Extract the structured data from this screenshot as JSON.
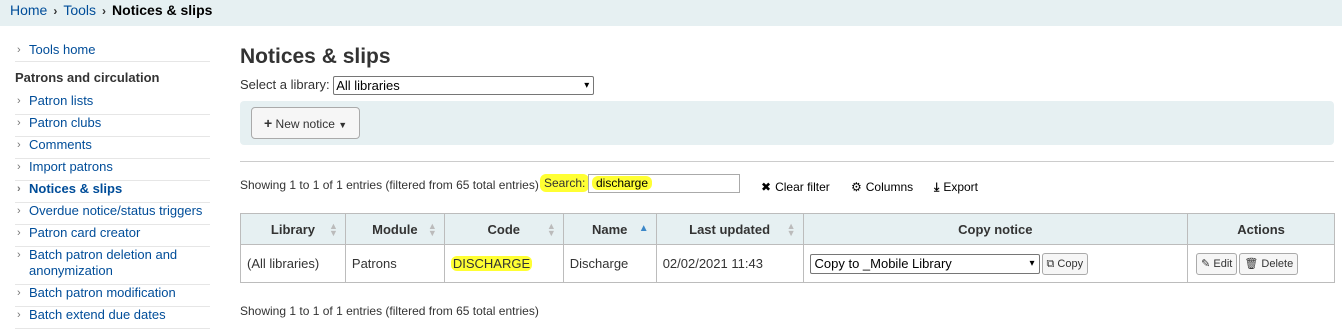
{
  "breadcrumb": {
    "home": "Home",
    "tools": "Tools",
    "current": "Notices & slips",
    "sep": "›"
  },
  "sidebar": {
    "heading": "Patrons and circulation",
    "arrow": "›",
    "items": [
      {
        "label": "Tools home"
      },
      {
        "label": "Patron lists"
      },
      {
        "label": "Patron clubs"
      },
      {
        "label": "Comments"
      },
      {
        "label": "Import patrons"
      },
      {
        "label": "Notices & slips"
      },
      {
        "label": "Overdue notice/status triggers"
      },
      {
        "label": "Patron card creator"
      },
      {
        "label": "Batch patron deletion and anonymization"
      },
      {
        "label": "Batch patron modification"
      },
      {
        "label": "Batch extend due dates"
      }
    ]
  },
  "main": {
    "title": "Notices & slips",
    "library_label": "Select a library:",
    "library_value": "All libraries",
    "new_notice": "New notice",
    "info_top": "Showing 1 to 1 of 1 entries (filtered from 65 total entries)",
    "info_bottom": "Showing 1 to 1 of 1 entries (filtered from 65 total entries)",
    "search_label": "Search:",
    "search_value": "discharge",
    "clear_filter": "Clear filter",
    "columns": "Columns",
    "export": "Export"
  },
  "table": {
    "headers": [
      "Library",
      "Module",
      "Code",
      "Name",
      "Last updated",
      "Copy notice",
      "Actions"
    ],
    "row": {
      "library": "(All libraries)",
      "module": "Patrons",
      "code": "DISCHARGE",
      "name": "Discharge",
      "last_updated": "02/02/2021 11:43",
      "copy_target": "Copy to _Mobile Library",
      "copy_btn": "Copy",
      "edit_btn": "Edit",
      "delete_btn": "Delete"
    }
  },
  "colors": {
    "accent_bg": "#e6f0f2",
    "link": "#004d99",
    "highlight": "#ffff33"
  }
}
